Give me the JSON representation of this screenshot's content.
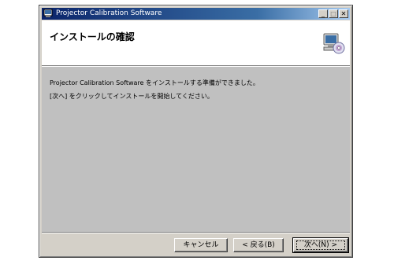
{
  "window": {
    "title": "Projector Calibration Software",
    "controls": {
      "minimize": "_",
      "maximize": "□",
      "close": "✕"
    }
  },
  "header": {
    "title": "インストールの確認",
    "icon": "computer-cd-icon"
  },
  "body": {
    "line1": "Projector Calibration Software をインストールする準備ができました。",
    "line2": "[次へ] をクリックしてインストールを開始してください。"
  },
  "buttons": {
    "cancel": "キャンセル",
    "back": "< 戻る(B)",
    "next": "次へ(N) >"
  },
  "colors": {
    "titlebar_start": "#0a246a",
    "titlebar_end": "#a6caf0",
    "dialog_face": "#d4d0c8",
    "body_background": "#c0c0c0"
  }
}
